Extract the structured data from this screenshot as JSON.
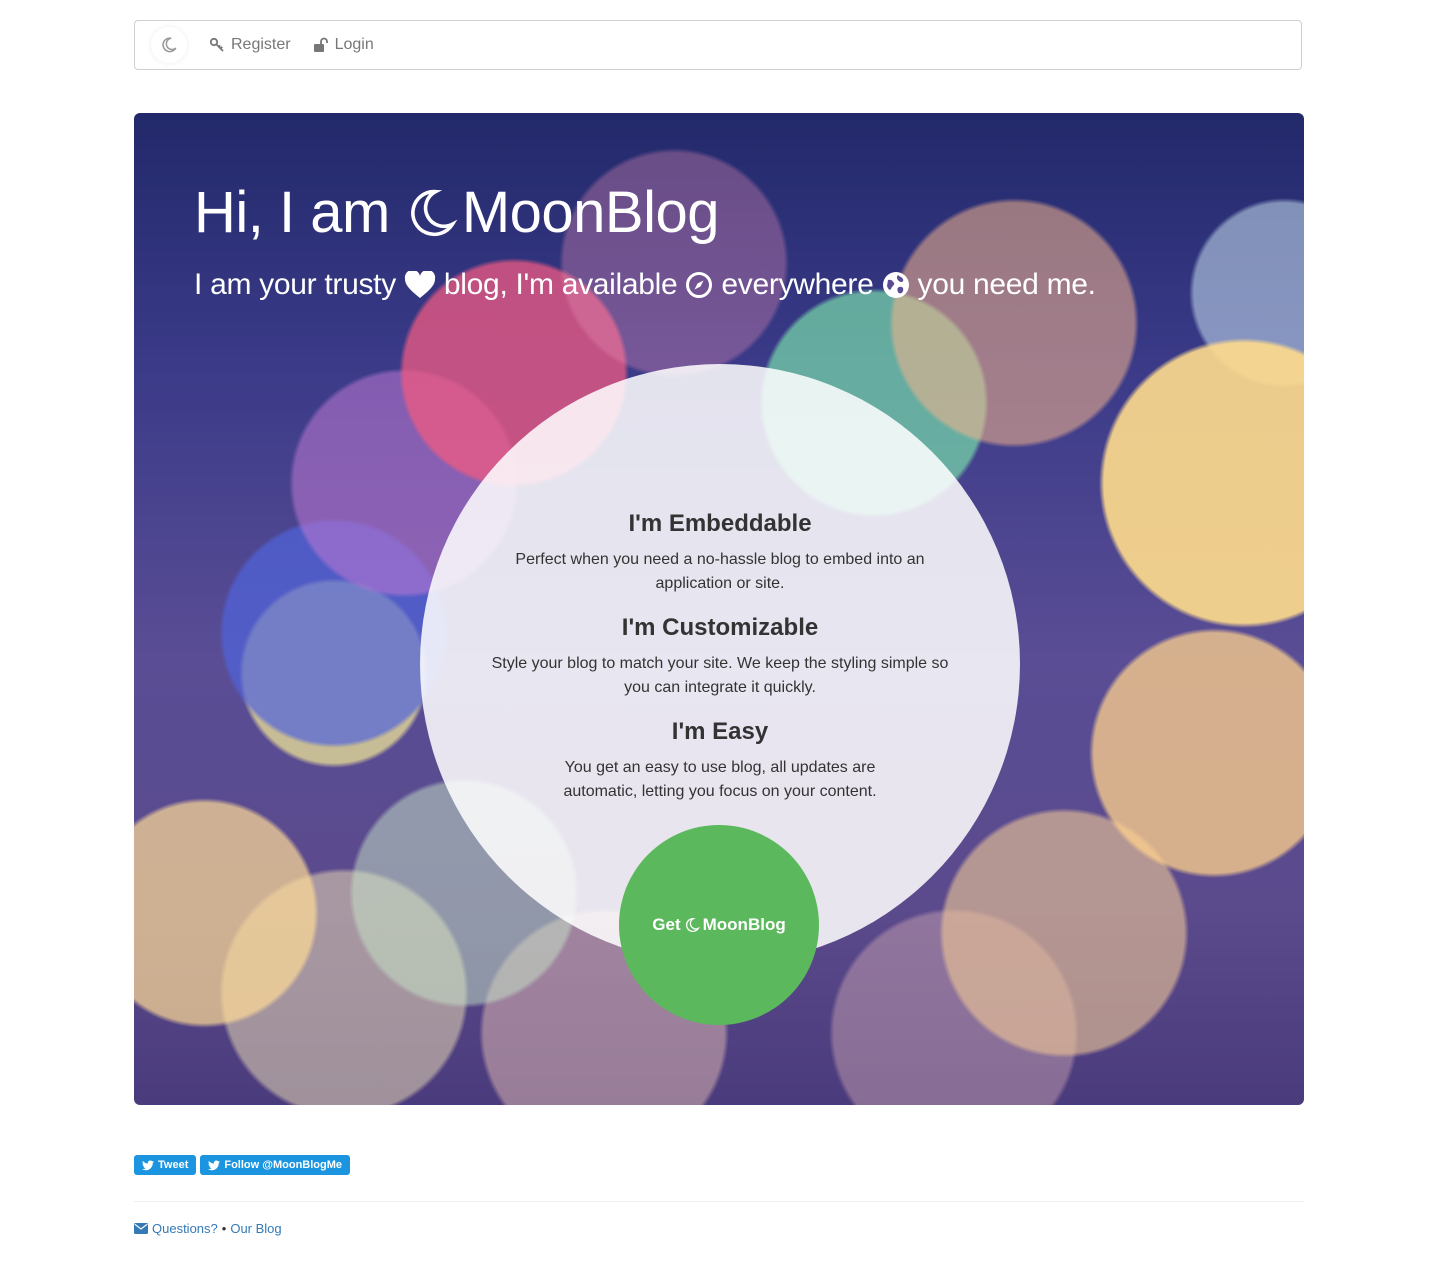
{
  "navbar": {
    "brand_icon": "moon-icon",
    "register_label": "Register",
    "register_icon": "key-icon",
    "login_label": "Login",
    "login_icon": "unlock-icon"
  },
  "hero": {
    "title_prefix": "Hi, I am",
    "title_brand": "MoonBlog",
    "subtitle_part1": "I am your trusty",
    "subtitle_part2": "blog, I'm available",
    "subtitle_part3": "everywhere",
    "subtitle_part4": "you need me.",
    "subtitle_icons": [
      "heart-icon",
      "compass-icon",
      "globe-icon"
    ]
  },
  "features": [
    {
      "title": "I'm Embeddable",
      "text_line1": "Perfect when you need a no-hassle blog to embed into an",
      "text_line2": "application or site."
    },
    {
      "title": "I'm Customizable",
      "text_line1": "Style your blog to match your site. We keep the styling simple so",
      "text_line2": "you can integrate it quickly."
    },
    {
      "title": "I'm Easy",
      "text_line1": "You get an easy to use blog, all updates are",
      "text_line2": "automatic, letting you focus on your content."
    }
  ],
  "cta": {
    "prefix": "Get",
    "brand": "MoonBlog",
    "color": "#5cb85c"
  },
  "social": {
    "tweet_label": "Tweet",
    "follow_label": "Follow @MoonBlogMe",
    "color": "#1b95e0"
  },
  "footer": {
    "questions_label": "Questions?",
    "separator": "•",
    "blog_label": "Our Blog",
    "link_color": "#337ab7"
  }
}
